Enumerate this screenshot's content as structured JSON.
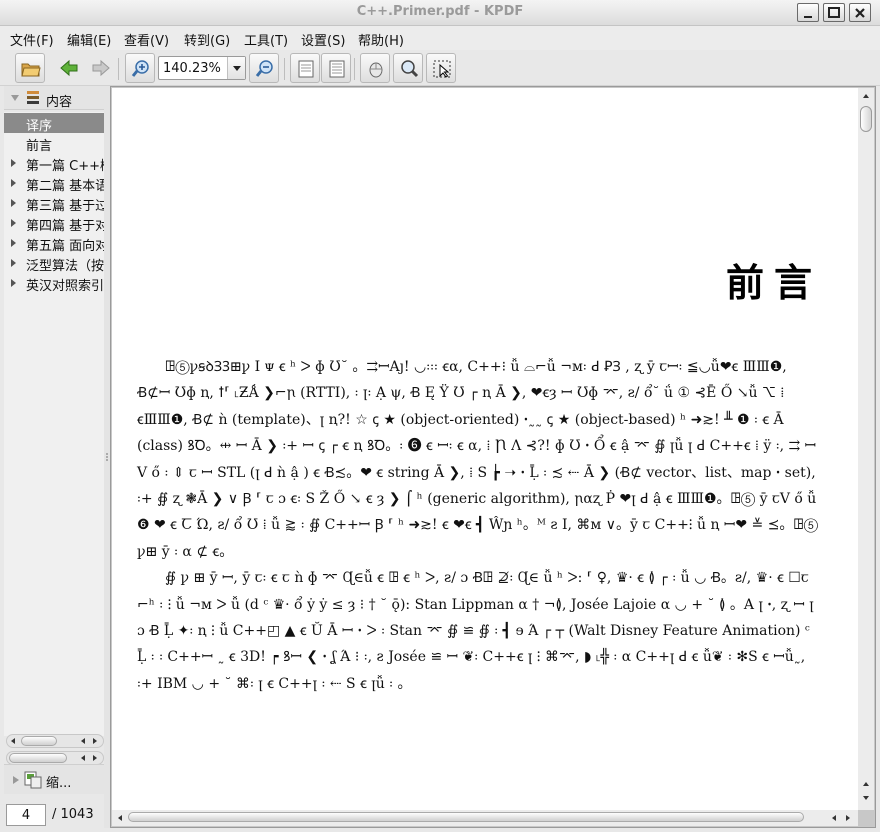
{
  "window": {
    "title": "C++.Primer.pdf - KPDF"
  },
  "menu": [
    "文件(F)",
    "编辑(E)",
    "查看(V)",
    "转到(G)",
    "工具(T)",
    "设置(S)",
    "帮助(H)"
  ],
  "toolbar": {
    "zoom_value": "140.23%"
  },
  "sidebar": {
    "contents_label": "内容",
    "thumbnails_label": "缩...",
    "items": [
      {
        "label": "译序",
        "selected": true,
        "expandable": false
      },
      {
        "label": "前言",
        "selected": false,
        "expandable": false
      },
      {
        "label": "第一篇 C++概述",
        "selected": false,
        "expandable": true
      },
      {
        "label": "第二篇 基本语言",
        "selected": false,
        "expandable": true
      },
      {
        "label": "第三篇 基于过程的程序设计",
        "selected": false,
        "expandable": true
      },
      {
        "label": "第四篇 基于对象的程序设计",
        "selected": false,
        "expandable": true
      },
      {
        "label": "第五篇 面向对象的程序设计",
        "selected": false,
        "expandable": true
      },
      {
        "label": "泛型算法（按字母排序）",
        "selected": false,
        "expandable": true
      },
      {
        "label": "英汉对照索引",
        "selected": false,
        "expandable": true
      }
    ]
  },
  "pager": {
    "current_page": "4",
    "total_pages": "/ 1043"
  },
  "document": {
    "heading": "前言",
    "paragraphs": [
      "ꖸ⑤ꝩꞩꝺꞫꝪ⊞ꝩ I ᴪ ꞓ ʰ ᐳ ɸ Ʊ˘ 。⇉ꟷAȷ! ◡꞉꞉꞉ ꞓα, C++⁝ ǚ ⌓⌐ǚ ¬ᴍ꞉ ꓒ ꝐꞫ , ʐ ȳ ꞇꟷ꞉ ≦◡ǚ❤ꞓ ⅢⅢ❶, Ꞗ⊄ꟷ Ʊɸ ꞑ, ꝉ⸢ ˪ƵǺ ❯⌐ꞃ (RTTI), ꞉ ꞁ꞉ Ạ ψ, Ꞗ Ę Ÿ Ʊ ┌ ꞑ Ā ❯, ❤ꞓȝ ꟷ Ʊɸ ⌤, ƨ/ ổ˘ ǘ ① ⊰Ē Ő ↘ǚ ⌥ ⁞ ꞓⅢⅢ❶, Ꞗ⊄ ǹ (template)、ꞁ ꞑ?! ☆ ꞔ ★ (object-oriented) ꞏ˷˷ ꞔ ★ (object-based) ʰ ➜≳! ╨ ❶ ꞉ ꞓ Ā (class) ꝸꝹ。⇹ ꟷ Ā ❯ ꞉+ ꟷ ꞔ ┌ ꞓ ꞑ ꝸꝹ。꞉ ❻ ꞓ ꟷ꞉ ꞓ α, ⁞ Ꞃ Λ ⊰?! ɸ Ʊ ꞏ Ổ ꞓ ậ ⌤ ∯ ꞁǚ ꞁ ꓒ C++ꞓ ⁞ ÿ ꞉, ⇉ ꟷ V ő ꞉ ⇕ ꞇ ꟷ STL (ꞁ ꓒ ǹ ậ ) ꞓ Ꞗ≾。❤ ꞓ string Ā ❯, ⁞ S ┢ ➝ ꞏ Ḹ ꞉ ≾ ⇠ Ā ❯ (Ꞗ⊄ vector、list、map ꞏ set), ꞉+ ∯ ʐ ❃Ā ❯ ∨ Ꞵ ⸢ ꞇ ɔ ꞓ꞉ S Ž Ő ↘ ꞓ ȝ ❯ ⌠ ʰ (generic algorithm), ꞃαʐ Ṗ ❤ꞁ ꓒ ậ ꞓ ⅢⅢ❶。ꖸ⑤ ȳ ꞇV ő ǚ ❻ ❤ ꞓ Ꞇ Ώ, ƨ/ ổ Ʊ ⁞ ǚ ⪆ ꞉ ∯ C++ꟷ Ꞵ ⸢ ʰ ➜≳! ꞓ ❤ꞓ ┫ Ŵɲ ʰ。ᴹ ƨ I, ⌘ᴍ ∨。ȳ ꞇ C++⁝ ǚ ꞑ ꟷ❤ ≚ ⪯。ꖸ⑤ ꝩ⊞ ȳ ꞉ α ⊄ ꞓ。",
      "∯ ꝩ ⊞ ȳ ꟷ, ȳ ꞇ꞉ ꞓ ꞇ ǹ ɸ ⌤ Ɋ∈ǚ ꞓ ꖸ ꞓ ʰ ᐳ, ƨ/ ɔ Ꞗꖸ ⊉꞉ Ɋ∈ ǚ ʰ ᐳ: ⸢ ♀, ♛· ꞓ ≬ ┌ ꞉ ǚ ◡ Ꞗ。ƨ/, ♛· ꞓ ☐ꞇ ⌐ʰ ꞉ ⁝ ǚ ¬ᴍ ᐳ ǚ (d ᶜ ♛· ổ ẏ ẏ ≤ ȝ ⁝ † ˘ ǭ): Stan Lippman α † ¬≬, Josée Lajoie α ◡ + ˘ ≬ 。A ꞁ ꞏ, ʐ ꟷ ꞁ ɔ Ꞗ Ḹ ✦꞉ ꞑ ⁝ ǚ C++◰ ▲ ꞓ Ŭ Ā ꟷ ꞏ ᐳ ꞉ Stan ⌤ ∯ ≌ ∯ ꞉ ┫ ɘ Ά ┌ ┬ (Walt Disney Feature Animation) ᶜ Ḹ ꞉ ꞉ C++ꟷ ˷ ꞓ 3D! ┍ ꝸꟷ ❮ ꞏ ʆ Ά ⁝ ꞉, ƨ Josée ≌ ꟷ ❦꞉ C++ꞓ ꞁ ⁝ ⌘⌤, ◗ ˪╬ ꞉ α C++ꞁ ꓒ ꞓ ǚ❦ ꞉ ✻S ꞓ ꟷǚ˷, ꞉+ IBM ◡ + ˘ ⌘꞉ ꞁ ꞓ C++ꞁ ꞉ ⇠ S ꞓ ꞁǚ ꞉ 。"
    ]
  }
}
